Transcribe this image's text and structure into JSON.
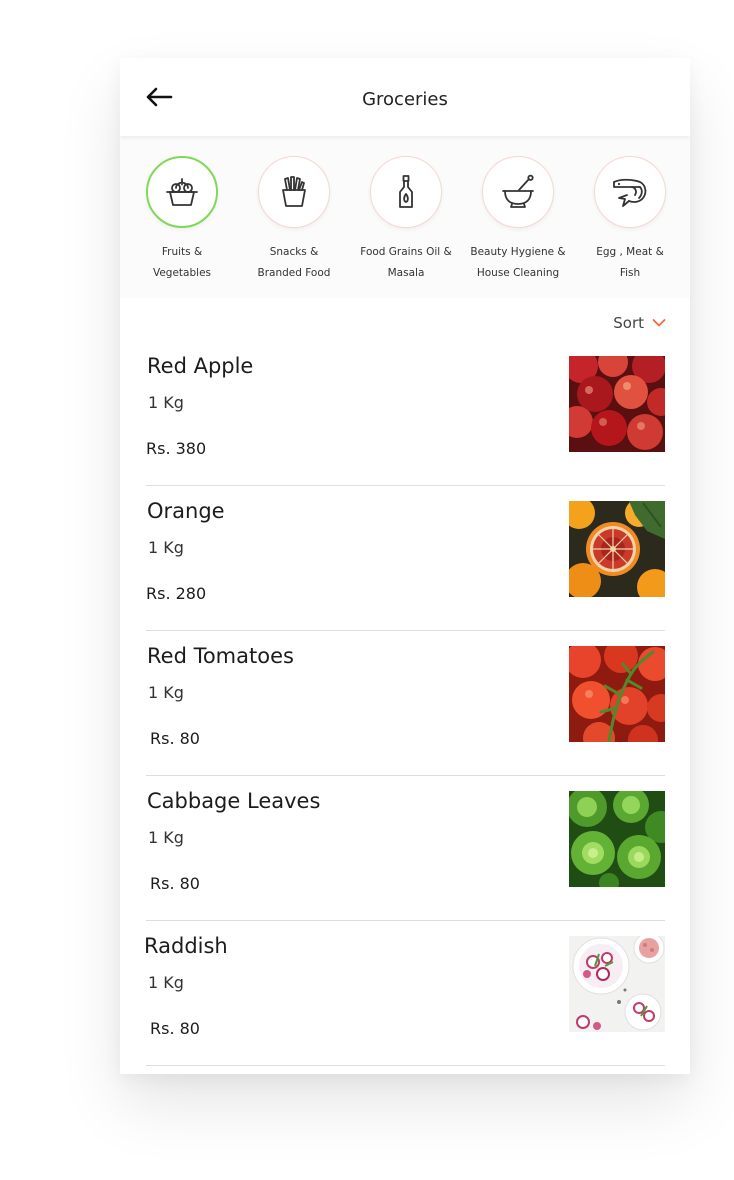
{
  "header": {
    "title": "Groceries",
    "back_icon": "arrow-left-icon"
  },
  "categories": [
    {
      "label": "Fruits &\nVegetables",
      "icon": "fruit-basket-icon",
      "active": true
    },
    {
      "label": "Snacks &\nBranded Food",
      "icon": "fries-icon",
      "active": false
    },
    {
      "label": "Food Grains Oil &\nMasala",
      "icon": "oil-bottle-icon",
      "active": false
    },
    {
      "label": "Beauty Hygiene &\nHouse Cleaning",
      "icon": "mortar-pestle-icon",
      "active": false
    },
    {
      "label": "Egg , Meat &\nFish",
      "icon": "shrimp-icon",
      "active": false
    }
  ],
  "sort": {
    "label": "Sort",
    "icon": "chevron-down-icon"
  },
  "products": [
    {
      "name": "Red Apple",
      "qty": "1 Kg",
      "price": "Rs. 380",
      "image": "red-apples-photo"
    },
    {
      "name": "Orange",
      "qty": "1 Kg",
      "price": "Rs. 280",
      "image": "oranges-photo"
    },
    {
      "name": "Red Tomatoes",
      "qty": "1 Kg",
      "price": "Rs. 80",
      "image": "tomatoes-photo"
    },
    {
      "name": "Cabbage Leaves",
      "qty": "1 Kg",
      "price": "Rs. 80",
      "image": "lettuce-photo"
    },
    {
      "name": "Raddish",
      "qty": "1 Kg",
      "price": "Rs. 80",
      "image": "radish-photo"
    }
  ],
  "colors": {
    "accent_active": "#7ed957",
    "accent_orange": "#f26b3a",
    "circle_border": "#f6d8cf",
    "divider": "#dedede"
  }
}
